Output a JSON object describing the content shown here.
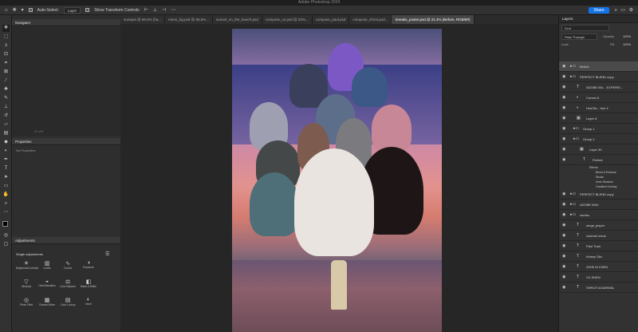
{
  "window": {
    "title": "Adobe Photoshop 2024"
  },
  "options_bar": {
    "auto_select_label": "Auto-Select:",
    "auto_select_target": "Layer",
    "show_transform_label": "Show Transform Controls",
    "share_label": "Share"
  },
  "left_panels": {
    "navigator_title": "Navigator",
    "zoom_value": "21.4%",
    "properties_title": "Properties",
    "properties_empty": "No Properties",
    "adjustments_title": "Adjustments",
    "single_adjustments_label": "Single adjustments",
    "adjustment_items": [
      "Brightness/Contrast",
      "Levels",
      "Curves",
      "Exposure",
      "Vibrance",
      "Hue/Saturation",
      "Color Balance",
      "Black & White",
      "Photo Filter",
      "Channel Mixer",
      "Color Lookup",
      "Invert"
    ]
  },
  "tabs": [
    "sunspot @ 56.5% (ha...",
    "menu_bg.psd @ 56.5%...",
    "sunset_on_the_beach.psd",
    "compose_vu.psd @ 22%...",
    "compose_paul.psd",
    "compose_shirut.psd...",
    "Sneaks_poster.psd @ 21.4% (Before, RGB/8#)"
  ],
  "layers_panel": {
    "title": "Layers",
    "search_placeholder": "Kind",
    "blend_mode": "Pass Through",
    "opacity_label": "Opacity:",
    "opacity_value": "100%",
    "lock_label": "Lock:",
    "fill_label": "Fill:",
    "fill_value": "100%",
    "layers": [
      {
        "name": "Before"
      },
      {
        "name": "PERFECT BLEND copy"
      },
      {
        "name": "ADOBE MA... EXPERIE..."
      },
      {
        "name": "Curves 8"
      },
      {
        "name": "Hue/Sa... tion 4"
      },
      {
        "name": "Layer 6"
      },
      {
        "name": "Group 1"
      },
      {
        "name": "Group 2"
      },
      {
        "name": "Layer 30"
      },
      {
        "name": "Perfect"
      },
      {
        "name": "PERFECT BLEND copy"
      },
      {
        "name": "ADOBE MAX"
      },
      {
        "name": "names"
      },
      {
        "name": "serge_jesper"
      },
      {
        "name": "coloma! meus"
      },
      {
        "name": "Paul Trani"
      },
      {
        "name": "Kelsey Sko"
      },
      {
        "name": "ZHISI M CHEN"
      },
      {
        "name": "VU SHEN"
      },
      {
        "name": "SHRUTI AGARWAL"
      }
    ],
    "effects_header": "Effects",
    "effects": [
      "Bevel & Emboss",
      "Stroke",
      "Inner Shadow",
      "Gradient Overlay"
    ]
  }
}
